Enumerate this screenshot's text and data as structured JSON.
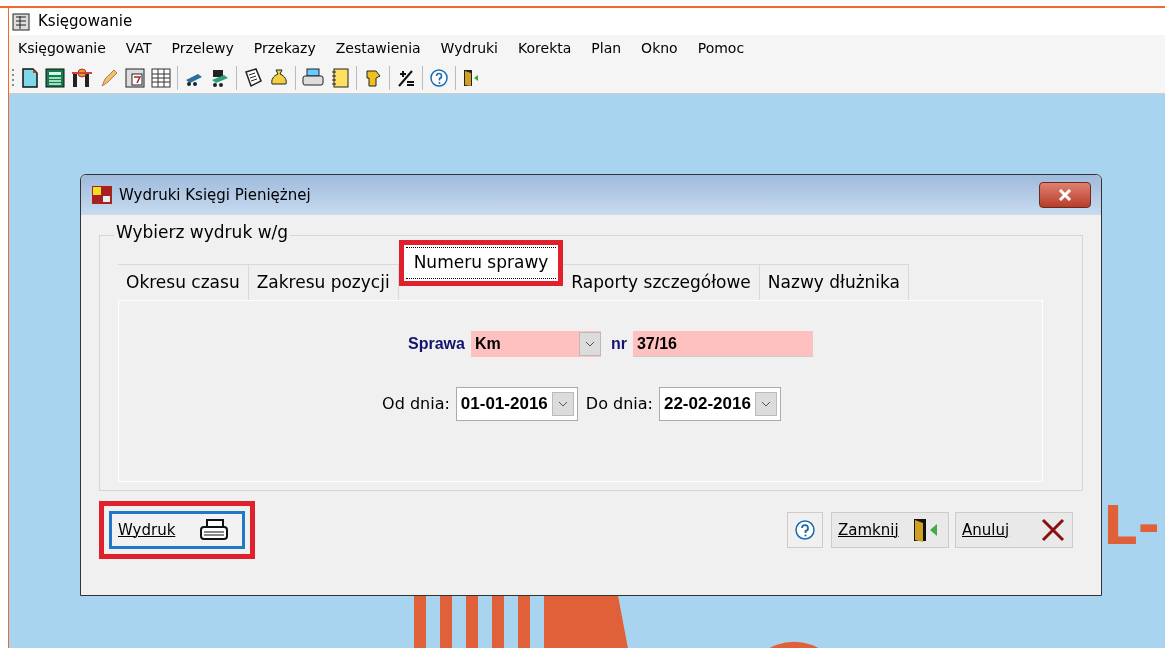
{
  "window": {
    "title": "Księgowanie"
  },
  "menu": [
    "Księgowanie",
    "VAT",
    "Przelewy",
    "Przekazy",
    "Zestawienia",
    "Wydruki",
    "Korekta",
    "Plan",
    "Okno",
    "Pomoc"
  ],
  "background": {
    "logo_text": "L-"
  },
  "dialog": {
    "title": "Wydruki Księgi Pieniężnej",
    "group_label": "Wybierz wydruk w/g",
    "tabs": [
      {
        "label": "Okresu czasu",
        "selected": false,
        "highlighted": false
      },
      {
        "label": "Zakresu pozycji",
        "selected": false,
        "highlighted": false
      },
      {
        "label": "Numeru sprawy",
        "selected": true,
        "highlighted": true
      },
      {
        "label": "Raporty szczegółowe",
        "selected": false,
        "highlighted": false
      },
      {
        "label": "Nazwy dłużnika",
        "selected": false,
        "highlighted": false
      }
    ],
    "case": {
      "label": "Sprawa",
      "type_value": "Km",
      "number_label": "nr",
      "number_value": "37/16"
    },
    "from": {
      "label": "Od dnia:",
      "value": "01-01-2016"
    },
    "to": {
      "label": "Do dnia:",
      "value": "22-02-2016"
    },
    "print_button": {
      "label": "Wydruk",
      "highlighted": true
    },
    "close_button": {
      "label": "Zamknij"
    },
    "cancel_button": {
      "label": "Anuluj"
    }
  }
}
